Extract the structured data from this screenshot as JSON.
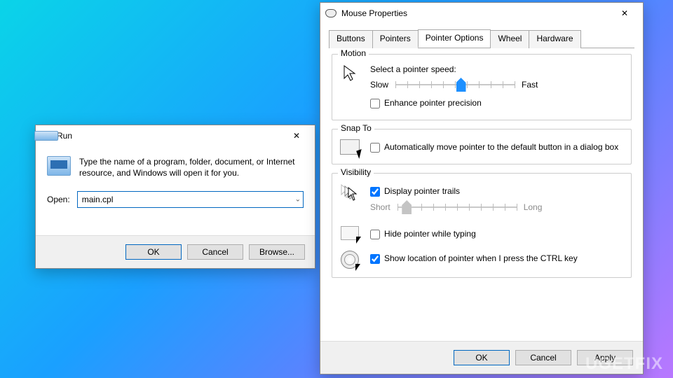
{
  "run": {
    "title": "Run",
    "description": "Type the name of a program, folder, document, or Internet resource, and Windows will open it for you.",
    "open_label": "Open:",
    "open_value": "main.cpl",
    "buttons": {
      "ok": "OK",
      "cancel": "Cancel",
      "browse": "Browse..."
    }
  },
  "mouse": {
    "title": "Mouse Properties",
    "tabs": [
      "Buttons",
      "Pointers",
      "Pointer Options",
      "Wheel",
      "Hardware"
    ],
    "active_tab": "Pointer Options",
    "motion": {
      "legend": "Motion",
      "select_label": "Select a pointer speed:",
      "slow": "Slow",
      "fast": "Fast",
      "speed_pos": 0.55,
      "enhance_label": "Enhance pointer precision",
      "enhance_checked": false
    },
    "snap": {
      "legend": "Snap To",
      "auto_label": "Automatically move pointer to the default button in a dialog box",
      "auto_checked": false
    },
    "visibility": {
      "legend": "Visibility",
      "trails_label": "Display pointer trails",
      "trails_checked": true,
      "short": "Short",
      "long": "Long",
      "trails_pos": 0.08,
      "hide_label": "Hide pointer while typing",
      "hide_checked": false,
      "locate_label": "Show location of pointer when I press the CTRL key",
      "locate_checked": true
    },
    "buttons": {
      "ok": "OK",
      "cancel": "Cancel",
      "apply": "Apply"
    }
  },
  "watermark": "UGETFIX"
}
